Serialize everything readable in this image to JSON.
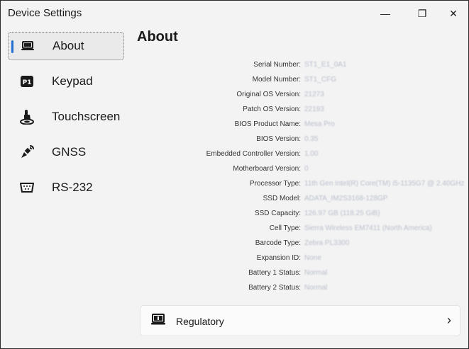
{
  "window": {
    "title": "Device Settings",
    "minimize_glyph": "—",
    "maximize_glyph": "❐",
    "close_glyph": "✕"
  },
  "sidebar": {
    "items": [
      {
        "label": "About",
        "icon": "laptop-info-icon",
        "active": true
      },
      {
        "label": "Keypad",
        "icon": "p1-key-icon",
        "active": false
      },
      {
        "label": "Touchscreen",
        "icon": "touch-hand-icon",
        "active": false
      },
      {
        "label": "GNSS",
        "icon": "satellite-icon",
        "active": false
      },
      {
        "label": "RS-232",
        "icon": "serial-port-icon",
        "active": false
      }
    ]
  },
  "main": {
    "title": "About",
    "specs": [
      {
        "label": "Serial Number:",
        "value": "ST1_E1_0A1"
      },
      {
        "label": "Model Number:",
        "value": "ST1_CFG"
      },
      {
        "label": "Original OS Version:",
        "value": "21273"
      },
      {
        "label": "Patch OS Version:",
        "value": "22193"
      },
      {
        "label": "BIOS Product Name:",
        "value": "Mesa Pro"
      },
      {
        "label": "BIOS Version:",
        "value": "0.35"
      },
      {
        "label": "Embedded Controller Version:",
        "value": "1.00"
      },
      {
        "label": "Motherboard Version:",
        "value": "0"
      },
      {
        "label": "Processor Type:",
        "value": "11th Gen Intel(R) Core(TM) i5-1135G7 @ 2.40GHz"
      },
      {
        "label": "SSD Model:",
        "value": "ADATA_IM2S3168-128GP"
      },
      {
        "label": "SSD Capacity:",
        "value": "126.97 GB (118.25 GiB)"
      },
      {
        "label": "Cell Type:",
        "value": "Sierra Wireless EM7411 (North America)"
      },
      {
        "label": "Barcode Type:",
        "value": "Zebra PL3300"
      },
      {
        "label": "Expansion ID:",
        "value": "None"
      },
      {
        "label": "Battery 1 Status:",
        "value": "Normal"
      },
      {
        "label": "Battery 2 Status:",
        "value": "Normal"
      }
    ],
    "regulatory": {
      "label": "Regulatory",
      "chevron": "›"
    }
  },
  "colors": {
    "accent": "#1f6fd6",
    "blurred_value": "#b9bfcc"
  }
}
